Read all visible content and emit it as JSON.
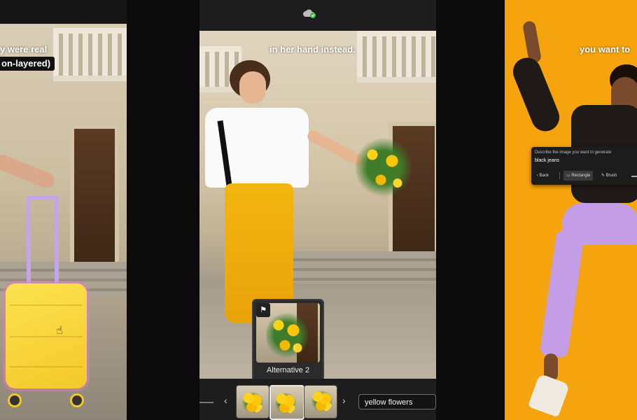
{
  "left_panel": {
    "caption_line1": "y were real",
    "caption_line2": "on-layered)"
  },
  "center_panel": {
    "caption": "in her hand instead.",
    "sync_icon": "cloud-check-icon",
    "popup_label": "Alternative 2",
    "popup_icon": "flag-icon",
    "prompt_value": "yellow flowers",
    "prev_icon": "chevron-left-icon",
    "next_icon": "chevron-right-icon"
  },
  "right_panel": {
    "caption": "you want to",
    "dialog": {
      "description": "Describe the image you want to generate",
      "value": "black jeans",
      "back_label": "Back",
      "rectangle_label": "Rectangle",
      "brush_label": "Brush"
    }
  },
  "colors": {
    "accent_yellow": "#f5a40d",
    "dark_ui": "#1d1d1d",
    "selection_pink": "#ec78c8"
  }
}
